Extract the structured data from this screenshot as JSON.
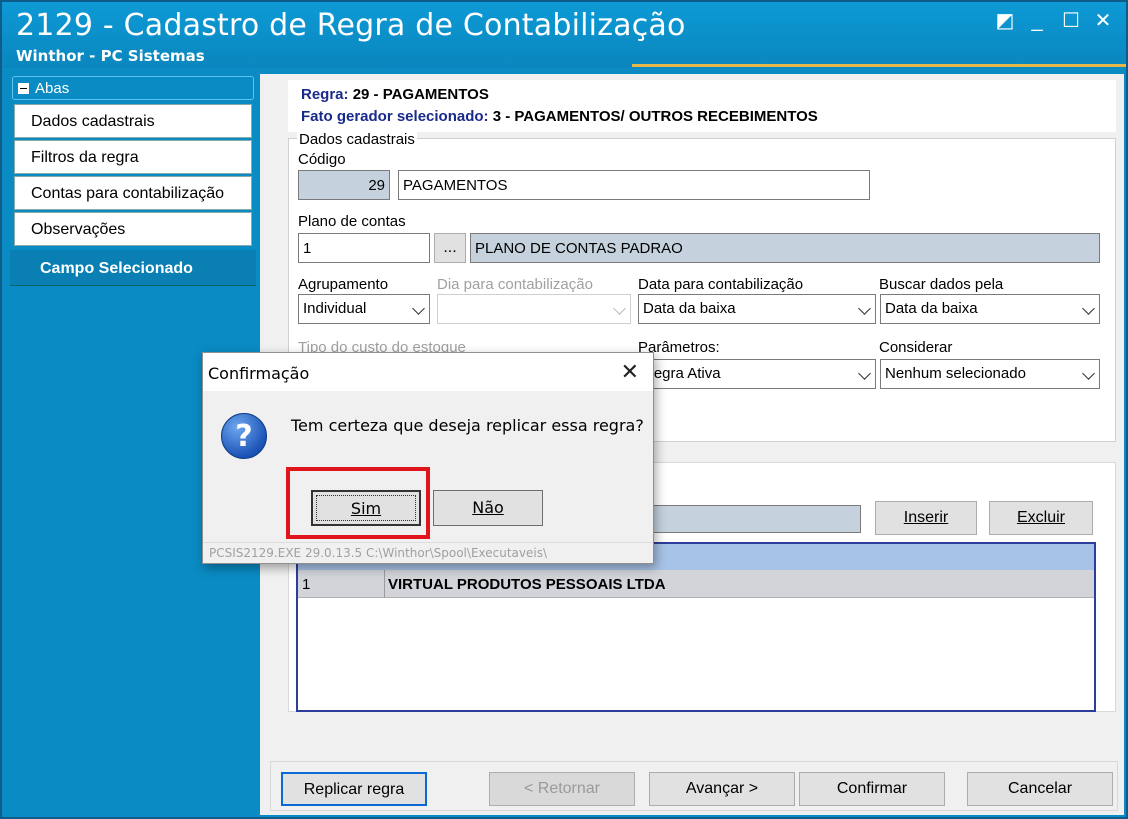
{
  "window": {
    "title": "2129 - Cadastro de Regra de Contabilização",
    "subtitle": "Winthor - PC Sistemas"
  },
  "sidebar": {
    "header": "Abas",
    "items": [
      {
        "label": "Dados cadastrais"
      },
      {
        "label": "Filtros da regra"
      },
      {
        "label": "Contas para contabilização"
      },
      {
        "label": "Observações"
      }
    ],
    "campo_selecionado": "Campo Selecionado"
  },
  "rule": {
    "regra_label": "Regra:",
    "regra_value": "29 - PAGAMENTOS",
    "fato_label": "Fato gerador selecionado:",
    "fato_value": "3 - PAGAMENTOS/ OUTROS RECEBIMENTOS"
  },
  "form": {
    "group_label": "Dados cadastrais",
    "codigo_label": "Código",
    "codigo_value": "29",
    "descricao_value": "PAGAMENTOS",
    "plano_label": "Plano de contas",
    "plano_value": "1",
    "plano_btn": "...",
    "plano_desc": "PLANO DE CONTAS PADRAO",
    "agrupamento_label": "Agrupamento",
    "agrupamento_value": "Individual",
    "dia_label": "Dia para contabilização",
    "dia_value": "",
    "data_label": "Data para contabilização",
    "data_value": "Data da baixa",
    "buscar_label": "Buscar dados pela",
    "buscar_value": "Data da baixa",
    "tipo_custo_label": "Tipo do custo do estoque",
    "parametros_label": "Parâmetros:",
    "parametros_value": "Regra Ativa",
    "considerar_label": "Considerar",
    "considerar_value": "Nenhum selecionado"
  },
  "filiais": {
    "inserir": "Inserir",
    "excluir": "Excluir",
    "rows": [
      {
        "code": "1",
        "name": "VIRTUAL PRODUTOS PESSOAIS LTDA"
      }
    ]
  },
  "footer_buttons": {
    "replicar": "Replicar regra",
    "retornar": "< Retornar",
    "avancar": "Avançar >",
    "confirmar": "Confirmar",
    "cancelar": "Cancelar"
  },
  "dialog": {
    "title": "Confirmação",
    "message": "Tem certeza que deseja replicar essa regra?",
    "yes": "Sim",
    "no": "Não",
    "footer": "PCSIS2129.EXE 29.0.13.5 C:\\Winthor\\Spool\\Executaveis\\",
    "icon": "question-icon"
  },
  "colors": {
    "accent": "#0a8bc4",
    "highlight": "#e0151b",
    "grid_header": "#a7c3e7"
  }
}
